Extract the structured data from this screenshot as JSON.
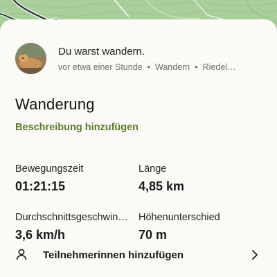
{
  "colors": {
    "accent": "#5b7a2a",
    "map_green": "#a9cf9c",
    "sheet_background": "#fbfaf7",
    "muted_text": "#6e6e6e"
  },
  "map": {
    "icon": "topographic-map"
  },
  "activity": {
    "avatar_icon": "dog-photo-avatar",
    "headline": "Du warst wandern.",
    "meta": {
      "time": "vor etwa einer Stunde",
      "type": "Wandern",
      "location": "Riedel…",
      "separator": "•"
    }
  },
  "details": {
    "title": "Wanderung",
    "add_description_label": "Beschreibung hinzufügen"
  },
  "stats": [
    {
      "label": "Bewegungszeit",
      "value": "01:21:15"
    },
    {
      "label": "Länge",
      "value": "4,85 km"
    },
    {
      "label": "Durchschnittsgeschwin…",
      "value": "3,6 km/h"
    },
    {
      "label": "Höhenunterschied",
      "value": "70 m"
    }
  ],
  "participants": {
    "label": "Teilnehmerinnen hinzufügen",
    "icon": "person-icon",
    "chevron_icon": "chevron-right-icon"
  }
}
